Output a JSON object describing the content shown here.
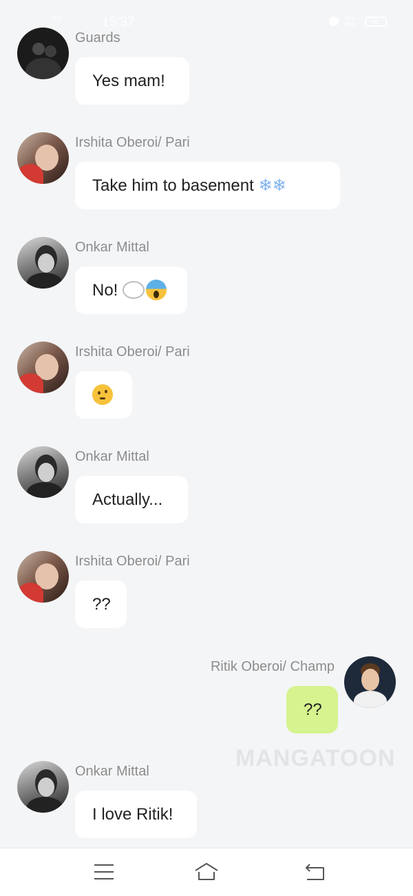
{
  "status_bar": {
    "time": "15:37",
    "signal_text": "4G",
    "speed_text": "29.4 KB/s",
    "battery": "65"
  },
  "messages": [
    {
      "sender": "Guards",
      "text": "Yes mam!",
      "side": "left"
    },
    {
      "sender": "Irshita Oberoi/ Pari",
      "text": "Take him to basement",
      "emoji": "❄️❄️",
      "side": "left"
    },
    {
      "sender": "Onkar Mittal",
      "text": "No!",
      "emoji": "💭😱",
      "side": "left"
    },
    {
      "sender": "Irshita Oberoi/ Pari",
      "text": "",
      "emoji": "🤨",
      "side": "left"
    },
    {
      "sender": "Onkar Mittal",
      "text": "Actually...",
      "side": "left"
    },
    {
      "sender": "Irshita Oberoi/ Pari",
      "text": "??",
      "side": "left"
    },
    {
      "sender": "Ritik Oberoi/ Champ",
      "text": "??",
      "side": "right"
    },
    {
      "sender": "Onkar Mittal",
      "text": "I love Ritik!",
      "side": "left"
    }
  ],
  "watermark": "MANGATOON",
  "icons": {
    "menu": "menu-icon",
    "home": "home-icon",
    "back": "back-icon"
  },
  "colors": {
    "background": "#f4f5f7",
    "bubble_other": "#ffffff",
    "bubble_mine": "#d6f38f",
    "sender_text": "#8c8c8c"
  }
}
